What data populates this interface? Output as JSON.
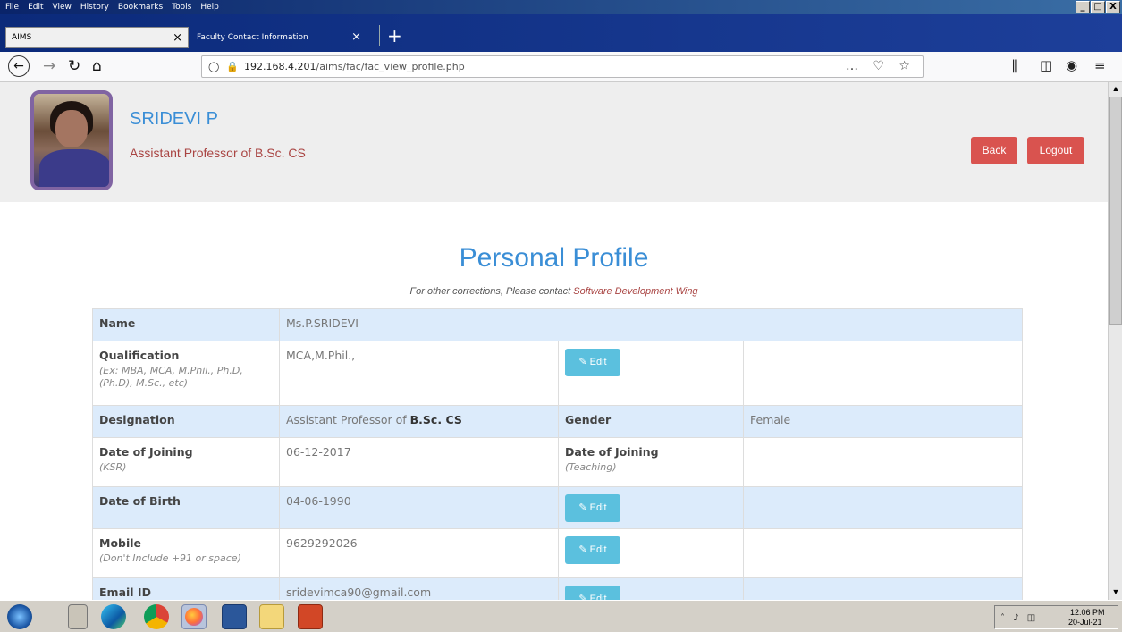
{
  "browser": {
    "menus": [
      "File",
      "Edit",
      "View",
      "History",
      "Bookmarks",
      "Tools",
      "Help"
    ],
    "window_controls": [
      "_",
      "□",
      "X"
    ],
    "tabs": [
      {
        "label": "AIMS",
        "close": "×"
      },
      {
        "label": "Faculty Contact Information",
        "close": "×"
      }
    ],
    "new_tab": "+",
    "url_host": "192.168.4.201",
    "url_path": "/aims/fac/fac_view_profile.php",
    "url_right_icons": "… ♡ ☆"
  },
  "header": {
    "name": "SRIDEVI P",
    "designation": "Assistant Professor of B.Sc. CS",
    "back_label": "Back",
    "logout_label": "Logout"
  },
  "page": {
    "title": "Personal Profile",
    "subtitle_prefix": "For other corrections, Please contact ",
    "subtitle_link": "Software Development Wing"
  },
  "profile": {
    "edit_label": "✎ Edit",
    "name_label": "Name",
    "name_value": "Ms.P.SRIDEVI",
    "qualification_label": "Qualification",
    "qualification_hint": "(Ex: MBA, MCA, M.Phil., Ph.D, (Ph.D), M.Sc., etc)",
    "qualification_value": "MCA,M.Phil.,",
    "designation_label": "Designation",
    "designation_prefix": "Assistant Professor of ",
    "designation_bold": "B.Sc. CS",
    "gender_label": "Gender",
    "gender_value": "Female",
    "doj_ksr_label": "Date of Joining",
    "doj_ksr_hint": "(KSR)",
    "doj_ksr_value": "06-12-2017",
    "doj_teaching_label": "Date of Joining",
    "doj_teaching_hint": "(Teaching)",
    "dob_label": "Date of Birth",
    "dob_value": "04-06-1990",
    "mobile_label": "Mobile",
    "mobile_hint": "(Don't Include +91 or space)",
    "mobile_value": "9629292026",
    "email_label": "Email ID",
    "email_value": "sridevimca90@gmail.com"
  },
  "taskbar": {
    "time": "12:06 PM",
    "date": "20-Jul-21"
  },
  "colors": {
    "accent_blue": "#3a8ed6",
    "danger_red": "#d9534f",
    "info_button": "#5bc0de",
    "row_highlight": "#dcebfb"
  }
}
